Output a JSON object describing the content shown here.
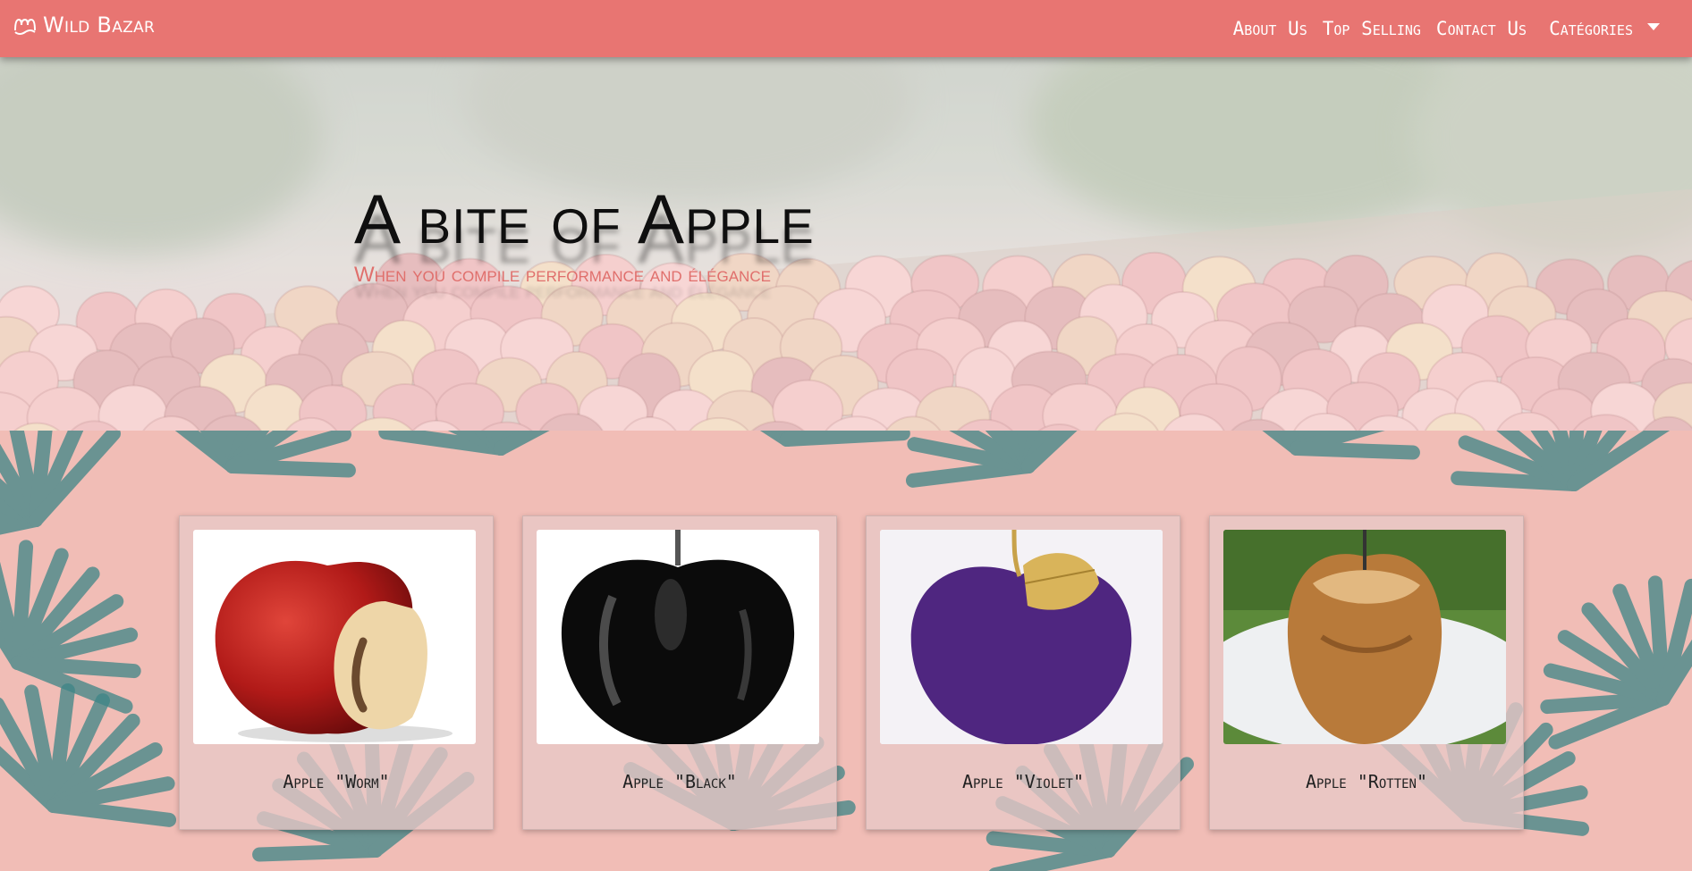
{
  "navbar": {
    "brand": "Wild Bazar",
    "brand_icon": "wave-logo-icon",
    "links": [
      "About Us",
      "Top Selling",
      "Contact Us"
    ],
    "dropdown_label": "Catégories"
  },
  "hero": {
    "title": "A bite of Apple",
    "subtitle": "When you compile performance and élégance"
  },
  "products": [
    {
      "label": "Apple \"Worm\"",
      "image": "bitten-red-apple-with-worm"
    },
    {
      "label": "Apple \"Black\"",
      "image": "glossy-black-apple"
    },
    {
      "label": "Apple \"Violet\"",
      "image": "purple-velvet-apple-with-gold-leaf"
    },
    {
      "label": "Apple \"Rotten\"",
      "image": "rotten-baked-apple"
    }
  ],
  "colors": {
    "navbar": "#e87572",
    "subtitle": "#e06f6c",
    "leaf": "#3d8586"
  }
}
